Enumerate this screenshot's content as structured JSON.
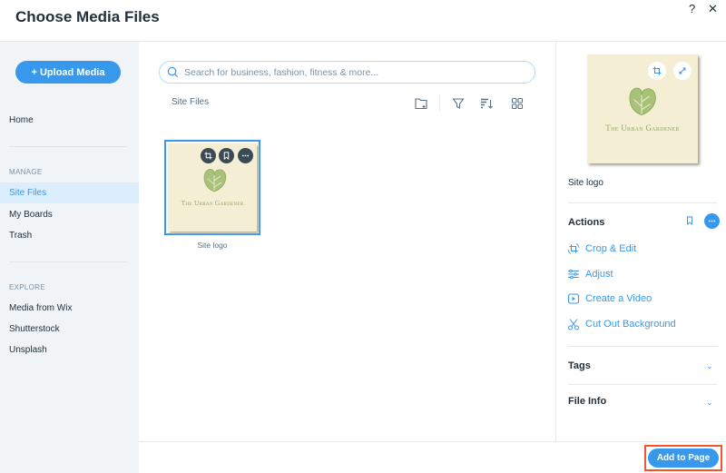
{
  "header": {
    "title": "Choose Media Files",
    "help_label": "?",
    "close_label": "✕"
  },
  "sidebar": {
    "upload_label": "+ Upload Media",
    "home_label": "Home",
    "sections": [
      {
        "title": "MANAGE",
        "items": [
          {
            "label": "Site Files",
            "active": true
          },
          {
            "label": "My Boards"
          },
          {
            "label": "Trash"
          }
        ]
      },
      {
        "title": "EXPLORE",
        "items": [
          {
            "label": "Media from Wix"
          },
          {
            "label": "Shutterstock"
          },
          {
            "label": "Unsplash"
          }
        ]
      }
    ]
  },
  "main": {
    "search_placeholder": "Search for business, fashion, fitness & more...",
    "breadcrumb": "Site Files",
    "toolbar": [
      "new-folder-icon",
      "filter-icon",
      "sort-icon",
      "grid-view-icon"
    ],
    "files": [
      {
        "name": "Site logo",
        "logo_text": "The Urban Gardener"
      }
    ]
  },
  "details": {
    "logo_text": "The Urban Gardener",
    "file_name": "Site logo",
    "actions_title": "Actions",
    "actions": [
      {
        "label": "Crop & Edit",
        "icon": "crop-icon"
      },
      {
        "label": "Adjust",
        "icon": "sliders-icon"
      },
      {
        "label": "Create a Video",
        "icon": "video-icon"
      },
      {
        "label": "Cut Out Background",
        "icon": "scissors-icon"
      }
    ],
    "tags_title": "Tags",
    "file_info_title": "File Info"
  },
  "footer": {
    "add_label": "Add to Page"
  },
  "colors": {
    "accent": "#3899ec",
    "highlight": "#f0552f",
    "logo_bg": "#f4eed5",
    "logo_green": "#8ea959"
  }
}
